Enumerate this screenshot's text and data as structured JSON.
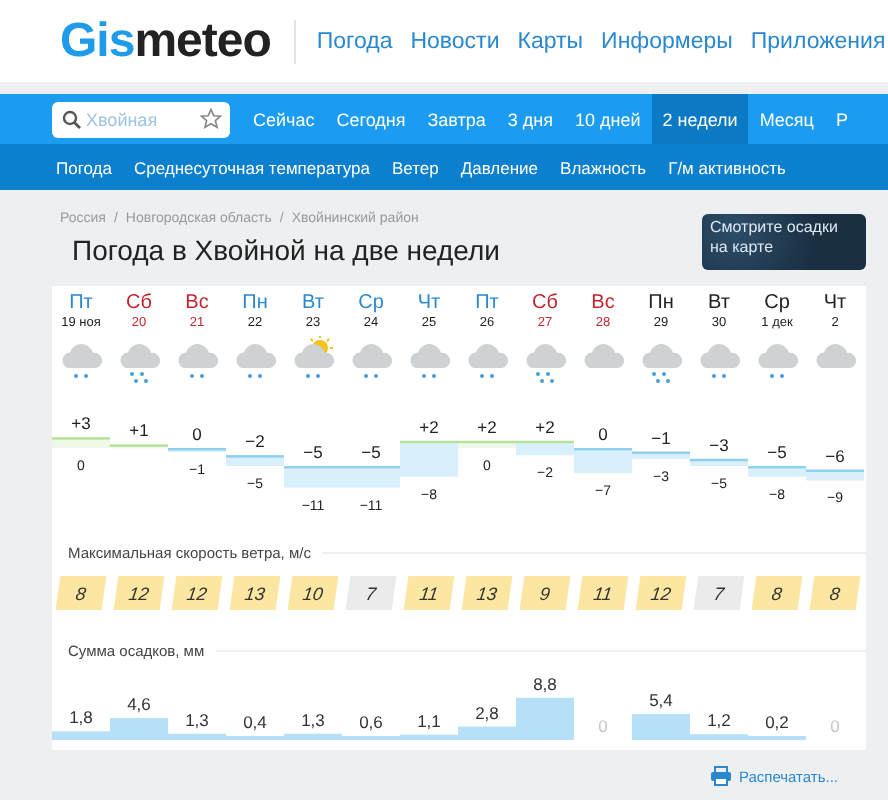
{
  "logo": {
    "accent": "Gis",
    "rest": "meteo"
  },
  "top_links": [
    "Погода",
    "Новости",
    "Карты",
    "Информеры",
    "Приложения"
  ],
  "search": {
    "placeholder": "Хвойная"
  },
  "tabs": [
    {
      "label": "Сейчас",
      "selected": false
    },
    {
      "label": "Сегодня",
      "selected": false
    },
    {
      "label": "Завтра",
      "selected": false
    },
    {
      "label": "3 дня",
      "selected": false
    },
    {
      "label": "10 дней",
      "selected": false
    },
    {
      "label": "2 недели",
      "selected": true
    },
    {
      "label": "Месяц",
      "selected": false
    },
    {
      "label": "Р",
      "selected": false
    }
  ],
  "subtabs": [
    "Погода",
    "Среднесуточная температура",
    "Ветер",
    "Давление",
    "Влажность",
    "Г/м активность"
  ],
  "breadcrumbs": [
    "Россия",
    "/",
    "Новгородская область",
    "/",
    "Хвойнинский район"
  ],
  "title": "Погода в Хвойной на две недели",
  "map_button": "Смотрите осадки на карте",
  "days": [
    {
      "name": "Пт",
      "date": "19 ноя",
      "kind": "weekday",
      "icon": {
        "kind": "light-snow",
        "sun": false
      },
      "max": "+3",
      "min": "0",
      "wind": {
        "value": "8",
        "color": "#fbe7a1"
      },
      "precip": "1,8"
    },
    {
      "name": "Сб",
      "date": "20",
      "kind": "weekend",
      "icon": {
        "kind": "heavy-snow",
        "sun": false
      },
      "max": "+1",
      "wind": {
        "value": "12",
        "color": "#fbe7a1"
      },
      "precip": "4,6"
    },
    {
      "name": "Вс",
      "date": "21",
      "kind": "weekend",
      "icon": {
        "kind": "light-snow",
        "sun": false
      },
      "max": "0",
      "min": "−1",
      "wind": {
        "value": "12",
        "color": "#fbe7a1"
      },
      "precip": "1,3"
    },
    {
      "name": "Пн",
      "date": "22",
      "kind": "weekday",
      "icon": {
        "kind": "light-snow",
        "sun": false
      },
      "max": "−2",
      "min": "−5",
      "wind": {
        "value": "13",
        "color": "#fbe7a1"
      },
      "precip": "0,4"
    },
    {
      "name": "Вт",
      "date": "23",
      "kind": "weekday",
      "icon": {
        "kind": "light-snow",
        "sun": true
      },
      "max": "−5",
      "min": "−11",
      "wind": {
        "value": "10",
        "color": "#fbe7a1"
      },
      "precip": "1,3"
    },
    {
      "name": "Ср",
      "date": "24",
      "kind": "weekday",
      "icon": {
        "kind": "light-snow",
        "sun": false
      },
      "max": "−5",
      "min": "−11",
      "wind": {
        "value": "7",
        "color": "#ebebeb"
      },
      "precip": "0,6"
    },
    {
      "name": "Чт",
      "date": "25",
      "kind": "weekday",
      "icon": {
        "kind": "light-snow",
        "sun": false
      },
      "max": "+2",
      "min": "−8",
      "wind": {
        "value": "11",
        "color": "#fbe7a1"
      },
      "precip": "1,1"
    },
    {
      "name": "Пт",
      "date": "26",
      "kind": "weekday",
      "icon": {
        "kind": "light-snow",
        "sun": false
      },
      "max": "+2",
      "min": "0",
      "wind": {
        "value": "13",
        "color": "#fbe7a1"
      },
      "precip": "2,8"
    },
    {
      "name": "Сб",
      "date": "27",
      "kind": "weekend",
      "icon": {
        "kind": "heavy-snow",
        "sun": false
      },
      "max": "+2",
      "min": "−2",
      "wind": {
        "value": "9",
        "color": "#fbe7a1"
      },
      "precip": "8,8"
    },
    {
      "name": "Вс",
      "date": "28",
      "kind": "weekend",
      "icon": {
        "kind": "cloudy",
        "sun": false
      },
      "max": "0",
      "min": "−7",
      "wind": {
        "value": "11",
        "color": "#fbe7a1"
      },
      "precip": "0"
    },
    {
      "name": "Пн",
      "date": "29",
      "kind": "extended",
      "icon": {
        "kind": "heavy-snow",
        "sun": false
      },
      "max": "−1",
      "min": "−3",
      "wind": {
        "value": "12",
        "color": "#fbe7a1"
      },
      "precip": "5,4"
    },
    {
      "name": "Вт",
      "date": "30",
      "kind": "extended",
      "icon": {
        "kind": "light-snow",
        "sun": false
      },
      "max": "−3",
      "min": "−5",
      "wind": {
        "value": "7",
        "color": "#ebebeb"
      },
      "precip": "1,2"
    },
    {
      "name": "Ср",
      "date": "1 дек",
      "kind": "extended",
      "icon": {
        "kind": "light-snow",
        "sun": false
      },
      "max": "−5",
      "min": "−8",
      "wind": {
        "value": "8",
        "color": "#fbe7a1"
      },
      "precip": "0,2"
    },
    {
      "name": "Чт",
      "date": "2",
      "kind": "extended",
      "icon": {
        "kind": "cloudy",
        "sun": false
      },
      "max": "−6",
      "min": "−9",
      "wind": {
        "value": "8",
        "color": "#fbe7a1"
      },
      "precip": "0"
    }
  ],
  "wind_title": "Максимальная скорость ветра, м/с",
  "precip_title": "Сумма осадков, мм",
  "print_link": "Распечатать..."
}
